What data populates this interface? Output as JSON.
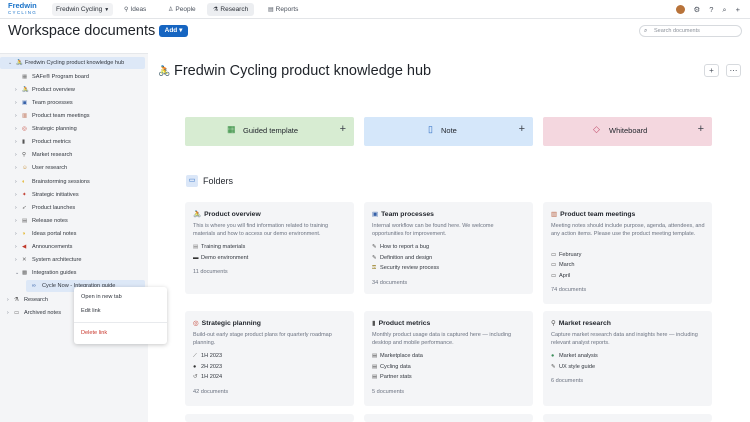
{
  "app": {
    "logo_line1": "Fredwin",
    "logo_line2": "CYCLING",
    "workspace": "Fredwin Cycling",
    "nav": [
      {
        "label": "Ideas",
        "icon": "lightbulb-icon"
      },
      {
        "label": "People",
        "icon": "person-icon"
      },
      {
        "label": "Research",
        "icon": "flask-icon"
      },
      {
        "label": "Reports",
        "icon": "chart-icon"
      }
    ],
    "active_tab": "Research"
  },
  "header": {
    "title": "Workspace documents",
    "add_label": "Add",
    "search_placeholder": "Search documents"
  },
  "sidebar": {
    "root": "Fredwin Cycling product knowledge hub",
    "items": [
      {
        "label": "SAFe® Program board",
        "icon": "board-icon"
      },
      {
        "label": "Product overview",
        "icon": "bike-icon"
      },
      {
        "label": "Team processes",
        "icon": "team-icon"
      },
      {
        "label": "Product team meetings",
        "icon": "calendar-icon"
      },
      {
        "label": "Strategic planning",
        "icon": "target-icon"
      },
      {
        "label": "Product metrics",
        "icon": "metrics-icon"
      },
      {
        "label": "Market research",
        "icon": "microscope-icon"
      },
      {
        "label": "User research",
        "icon": "user-icon"
      },
      {
        "label": "Brainstorming sessions",
        "icon": "bulb-icon"
      },
      {
        "label": "Strategic initiatives",
        "icon": "compass-icon"
      },
      {
        "label": "Product launches",
        "icon": "rocket-icon"
      },
      {
        "label": "Release notes",
        "icon": "notes-icon"
      },
      {
        "label": "Ideas portal notes",
        "icon": "lightbulb-icon"
      },
      {
        "label": "Announcements",
        "icon": "megaphone-icon"
      },
      {
        "label": "System architecture",
        "icon": "tools-icon"
      },
      {
        "label": "Integration guides",
        "icon": "puzzle-icon"
      },
      {
        "label": "Cycle Now - Integration guide",
        "icon": "link-icon"
      },
      {
        "label": "Research",
        "icon": "flask-icon"
      },
      {
        "label": "Archived notes",
        "icon": "folder-icon"
      }
    ]
  },
  "context_menu": {
    "open_new_tab": "Open in new tab",
    "edit_link": "Edit link",
    "delete_link": "Delete link"
  },
  "main": {
    "title": "Fredwin Cycling product knowledge hub",
    "tiles": [
      {
        "label": "Guided template",
        "color": "#d7ecd2"
      },
      {
        "label": "Note",
        "color": "#d5e7fa"
      },
      {
        "label": "Whiteboard",
        "color": "#f4d7df"
      }
    ],
    "folders_label": "Folders",
    "cards": [
      {
        "title": "Product overview",
        "desc": "This is where you will find information related to training materials and how to access our demo environment.",
        "items": [
          "Training materials",
          "Demo environment"
        ],
        "count": "11 documents"
      },
      {
        "title": "Team processes",
        "desc": "Internal workflow can be found here. We welcome opportunities for improvement.",
        "items": [
          "How to report a bug",
          "Definition and design",
          "Security review process"
        ],
        "count": "34 documents"
      },
      {
        "title": "Product team meetings",
        "desc": "Meeting notes should include purpose, agenda, attendees, and any action items. Please use the product meeting template.",
        "items": [
          "February",
          "March",
          "April"
        ],
        "count": "74 documents"
      },
      {
        "title": "Strategic planning",
        "desc": "Build-out early stage product plans for quarterly roadmap planning.",
        "items": [
          "1H 2023",
          "2H 2023",
          "1H 2024"
        ],
        "count": "42 documents"
      },
      {
        "title": "Product metrics",
        "desc": "Monthly product usage data is captured here — including desktop and mobile performance.",
        "items": [
          "Marketplace data",
          "Cycling data",
          "Partner stats"
        ],
        "count": "5 documents"
      },
      {
        "title": "Market research",
        "desc": "Capture market research data and insights here — including relevant analyst reports.",
        "items": [
          "Market analysis",
          "UX style guide"
        ],
        "count": "6 documents"
      }
    ]
  }
}
